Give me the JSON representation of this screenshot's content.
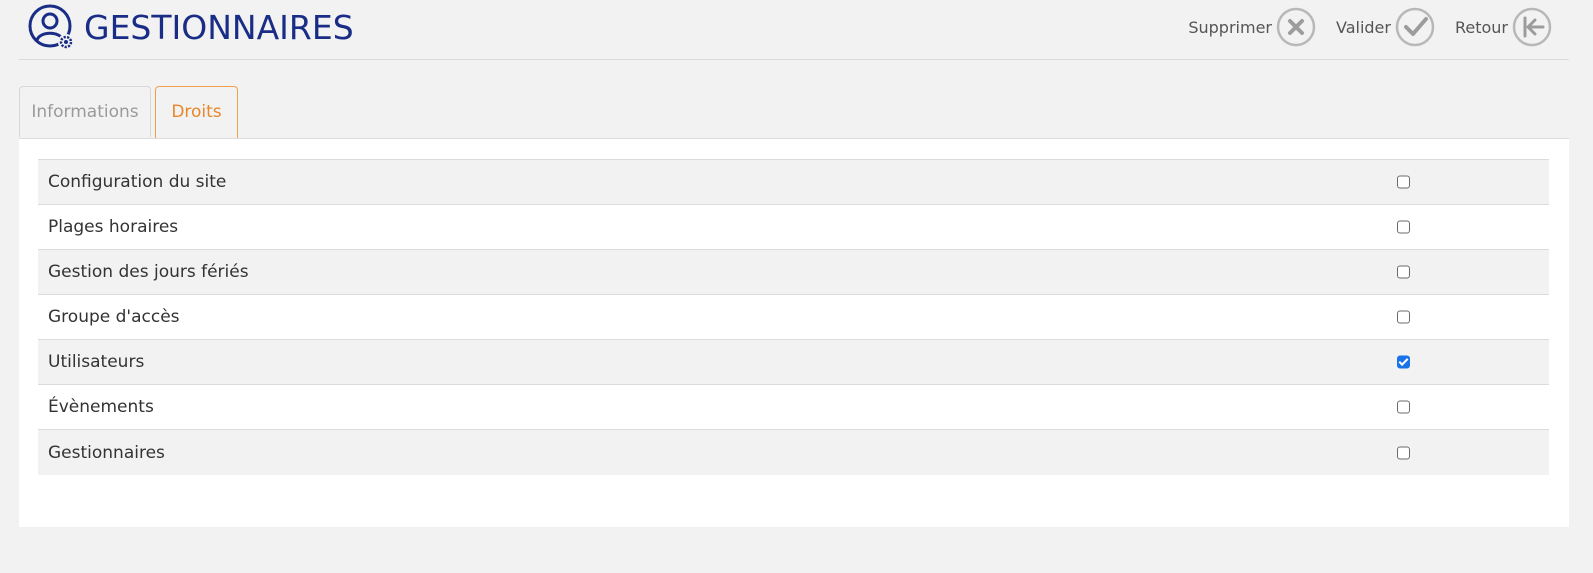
{
  "header": {
    "title": "GESTIONNAIRES",
    "title_icon": "user-gear-icon",
    "brand_color": "#1a2d86",
    "actions": [
      {
        "label": "Supprimer",
        "icon": "circle-x-icon"
      },
      {
        "label": "Valider",
        "icon": "circle-check-icon"
      },
      {
        "label": "Retour",
        "icon": "circle-back-arrow-icon"
      }
    ]
  },
  "tabs": [
    {
      "label": "Informations",
      "active": false
    },
    {
      "label": "Droits",
      "active": true
    }
  ],
  "active_tab_color": "#e8872a",
  "rights": [
    {
      "label": "Configuration du site",
      "checked": false
    },
    {
      "label": "Plages horaires",
      "checked": false
    },
    {
      "label": "Gestion des jours fériés",
      "checked": false
    },
    {
      "label": "Groupe d'accès",
      "checked": false
    },
    {
      "label": "Utilisateurs",
      "checked": true
    },
    {
      "label": "Évènements",
      "checked": false
    },
    {
      "label": "Gestionnaires",
      "checked": false
    }
  ]
}
